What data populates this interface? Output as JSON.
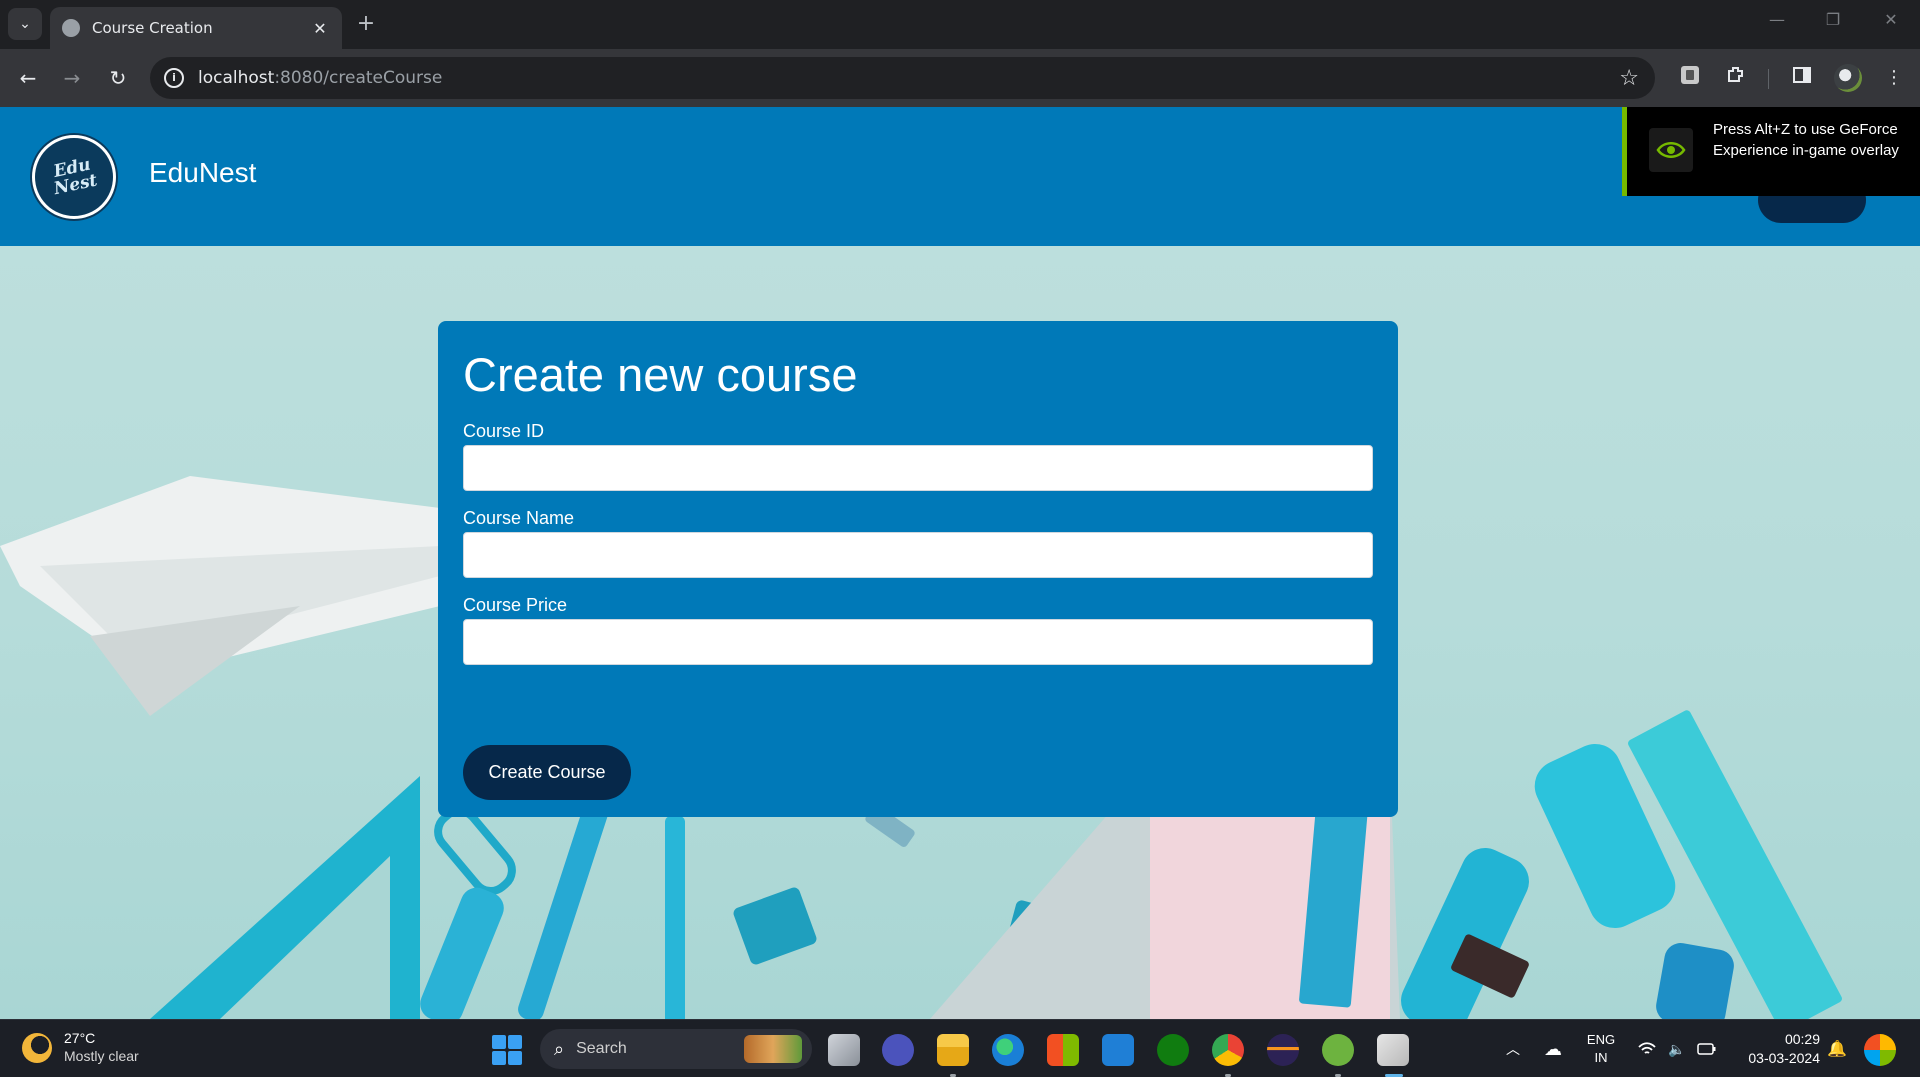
{
  "browser": {
    "tab_title": "Course Creation",
    "tab_close": "✕",
    "new_tab": "+",
    "url_host": "localhost",
    "url_path": ":8080/createCourse"
  },
  "header": {
    "logo_text": "Edu Nest",
    "brand": "EduNest"
  },
  "overlay": {
    "text": "Press Alt+Z to use GeForce Experience in-game overlay"
  },
  "form": {
    "title": "Create new course",
    "fields": [
      {
        "label": "Course ID",
        "value": ""
      },
      {
        "label": "Course Name",
        "value": ""
      },
      {
        "label": "Course Price",
        "value": ""
      }
    ],
    "submit_label": "Create Course"
  },
  "taskbar": {
    "weather_temp": "27°C",
    "weather_desc": "Mostly clear",
    "search_label": "Search",
    "lang_top": "ENG",
    "lang_bottom": "IN",
    "time": "00:29",
    "date": "03-03-2024"
  },
  "colors": {
    "header_blue": "#0079b8",
    "button_navy": "#06284a",
    "nvidia_green": "#76b900"
  }
}
